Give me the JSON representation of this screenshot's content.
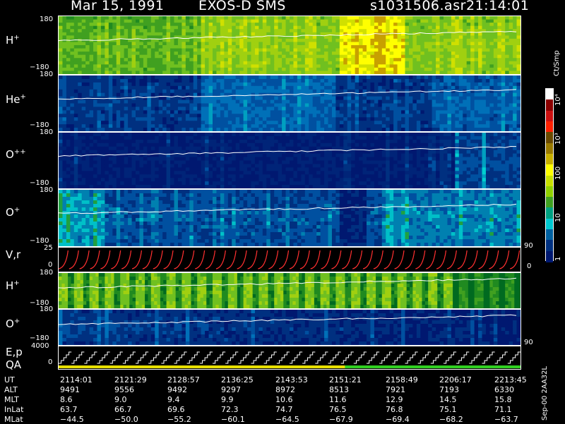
{
  "header": {
    "date": "Mar 15, 1991",
    "instrument": "EXOS-D SMS",
    "file": "s1031506.asr",
    "time": "21:14:01"
  },
  "panels": [
    {
      "id": "h-plus",
      "species": "H",
      "charge": "+",
      "top_tick": "180",
      "bottom_tick": "−180"
    },
    {
      "id": "he-plus",
      "species": "He",
      "charge": "+",
      "top_tick": "180",
      "bottom_tick": "−180"
    },
    {
      "id": "o-plus-plus",
      "species": "O",
      "charge": "++",
      "top_tick": "180",
      "bottom_tick": "−180"
    },
    {
      "id": "o-plus",
      "species": "O",
      "charge": "+",
      "top_tick": "180",
      "bottom_tick": "−180"
    },
    {
      "id": "vr",
      "species": "V,r",
      "charge": "",
      "top_tick": "25",
      "bottom_tick": "0"
    },
    {
      "id": "h-plus-2",
      "species": "H",
      "charge": "+",
      "top_tick": "180",
      "bottom_tick": "−180"
    },
    {
      "id": "o-plus-2",
      "species": "O",
      "charge": "+",
      "top_tick": "180",
      "bottom_tick": "−180"
    },
    {
      "id": "ep-qa",
      "species": "E,p",
      "charge": "",
      "label2": "QA",
      "top_tick": "4000",
      "bottom_tick": "0"
    }
  ],
  "right_ticks": {
    "vr_90": "90",
    "vr_0": "0",
    "o2_90": "90"
  },
  "colorbar": {
    "unit": "Ct/Smp",
    "labels": [
      "10⁴",
      "10³",
      "100",
      "10",
      "1"
    ],
    "colors": [
      "#ffffff",
      "#8b0000",
      "#cc1010",
      "#ff2000",
      "#6a4a00",
      "#9a7a00",
      "#c8b000",
      "#ffff00",
      "#c8e000",
      "#90d000",
      "#40a020",
      "#00a080",
      "#00c8d0",
      "#0060a0",
      "#003080",
      "#001870"
    ]
  },
  "chart_data": {
    "type": "heatmap",
    "title": "EXOS-D SMS",
    "panels": [
      "H+",
      "He+",
      "O++",
      "O+",
      "V,r",
      "H+",
      "O+",
      "E,p QA"
    ],
    "ylim_angle": [
      -180,
      180
    ],
    "ylim_vr": [
      0,
      25
    ],
    "ylim_ep": [
      0,
      4000
    ],
    "colorbar_unit": "Ct/Smp",
    "colorbar_ticks": [
      "1",
      "10",
      "100",
      "10³",
      "10⁴"
    ]
  },
  "footer": {
    "row_labels": [
      "UT",
      "ALT",
      "MLT",
      "InLat",
      "MLat"
    ],
    "columns": [
      {
        "UT": "2114:01",
        "ALT": "9491",
        "MLT": "8.6",
        "InLat": "63.7",
        "MLat": "−44.5"
      },
      {
        "UT": "2121:29",
        "ALT": "9556",
        "MLT": "9.0",
        "InLat": "66.7",
        "MLat": "−50.0"
      },
      {
        "UT": "2128:57",
        "ALT": "9492",
        "MLT": "9.4",
        "InLat": "69.6",
        "MLat": "−55.2"
      },
      {
        "UT": "2136:25",
        "ALT": "9297",
        "MLT": "9.9",
        "InLat": "72.3",
        "MLat": "−60.1"
      },
      {
        "UT": "2143:53",
        "ALT": "8972",
        "MLT": "10.6",
        "InLat": "74.7",
        "MLat": "−64.5"
      },
      {
        "UT": "2151:21",
        "ALT": "8513",
        "MLT": "11.6",
        "InLat": "76.5",
        "MLat": "−67.9"
      },
      {
        "UT": "2158:49",
        "ALT": "7921",
        "MLT": "12.9",
        "InLat": "76.8",
        "MLat": "−69.4"
      },
      {
        "UT": "2206:17",
        "ALT": "7193",
        "MLT": "14.5",
        "InLat": "75.1",
        "MLat": "−68.2"
      },
      {
        "UT": "2213:45",
        "ALT": "6330",
        "MLT": "15.8",
        "InLat": "71.1",
        "MLat": "−63.7"
      }
    ],
    "side_note": "Sep-00 2AA32L"
  }
}
